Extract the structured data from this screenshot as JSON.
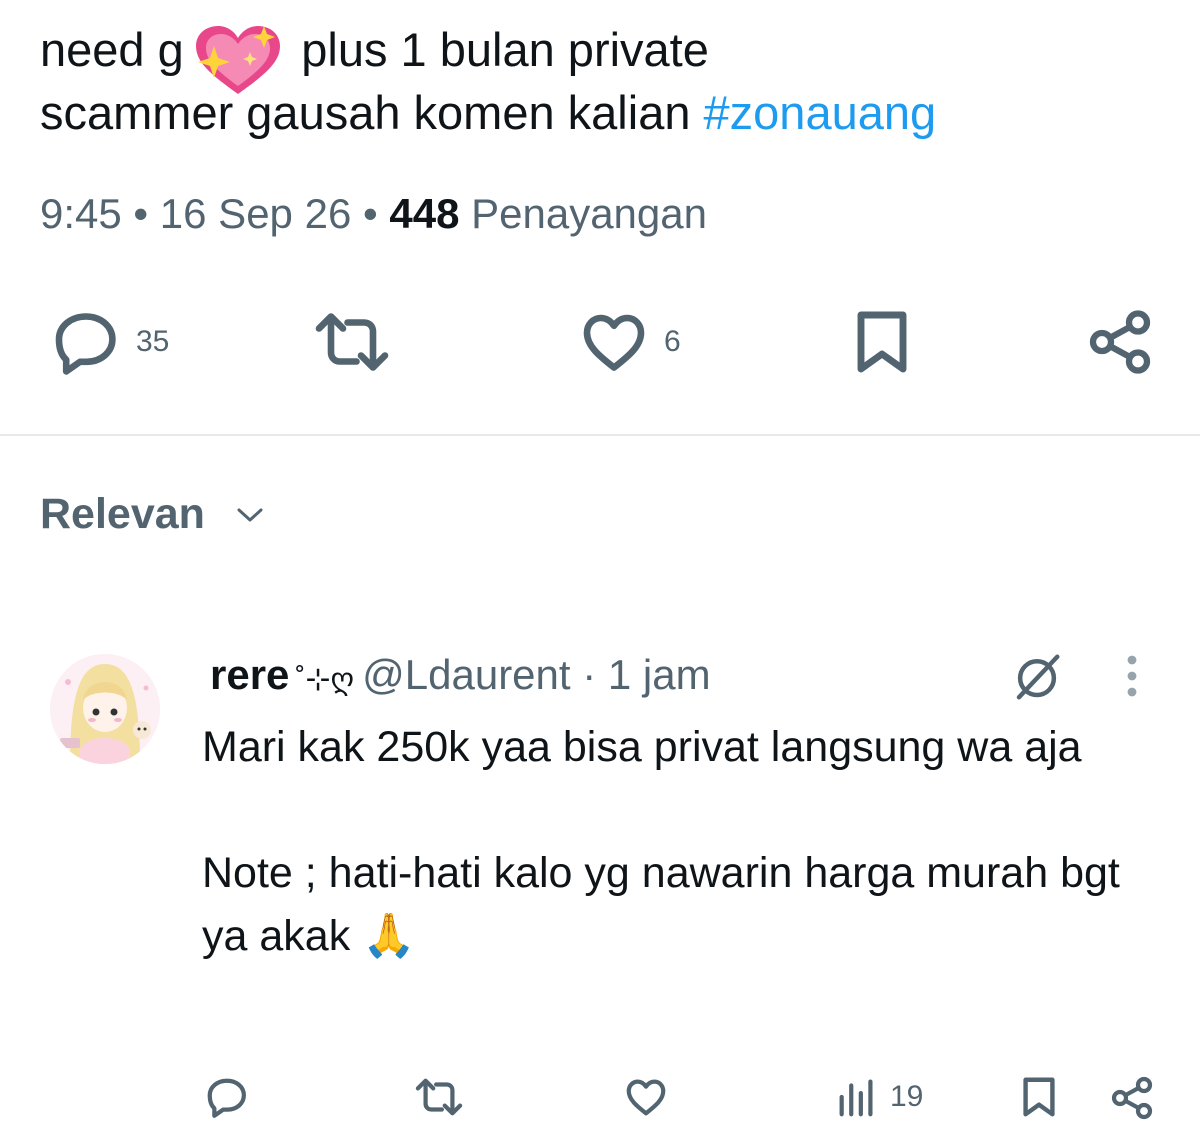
{
  "tweet": {
    "line1": "need g         plus 1 bulan private",
    "line2_text": "scammer gausah komen kalian ",
    "hashtag": "#zonauang",
    "time": "9:45",
    "sep1": " • ",
    "date": "16 Sep 26",
    "sep2": " • ",
    "views_count": "448",
    "views_label": " Penayangan",
    "emoji_overlay": "sparkling-heart-emoji"
  },
  "actions": {
    "reply_count": "35",
    "retweet_count": "",
    "like_count": "6",
    "reply_icon": "reply-icon",
    "retweet_icon": "retweet-icon",
    "like_icon": "heart-icon",
    "bookmark_icon": "bookmark-icon",
    "share_icon": "share-icon"
  },
  "sort": {
    "label": "Relevan",
    "icon": "chevron-down-icon"
  },
  "reply": {
    "name": "rere",
    "name_deco": "˚⊹ღ",
    "handle": "@Ldaurent",
    "sep": " · ",
    "time": "1 jam",
    "paragraph1": "Mari kak 250k yaa bisa privat langsung wa aja",
    "paragraph2": "Note ; hati-hati kalo yg nawarin harga murah bgt ya akak 🙏",
    "views_count": "19",
    "grok_icon": "grok-icon",
    "more_icon": "more-vertical-icon"
  },
  "colors": {
    "text": "#0f1419",
    "secondary": "#536471",
    "link": "#1d9bf0",
    "divider": "#e7eaed"
  }
}
